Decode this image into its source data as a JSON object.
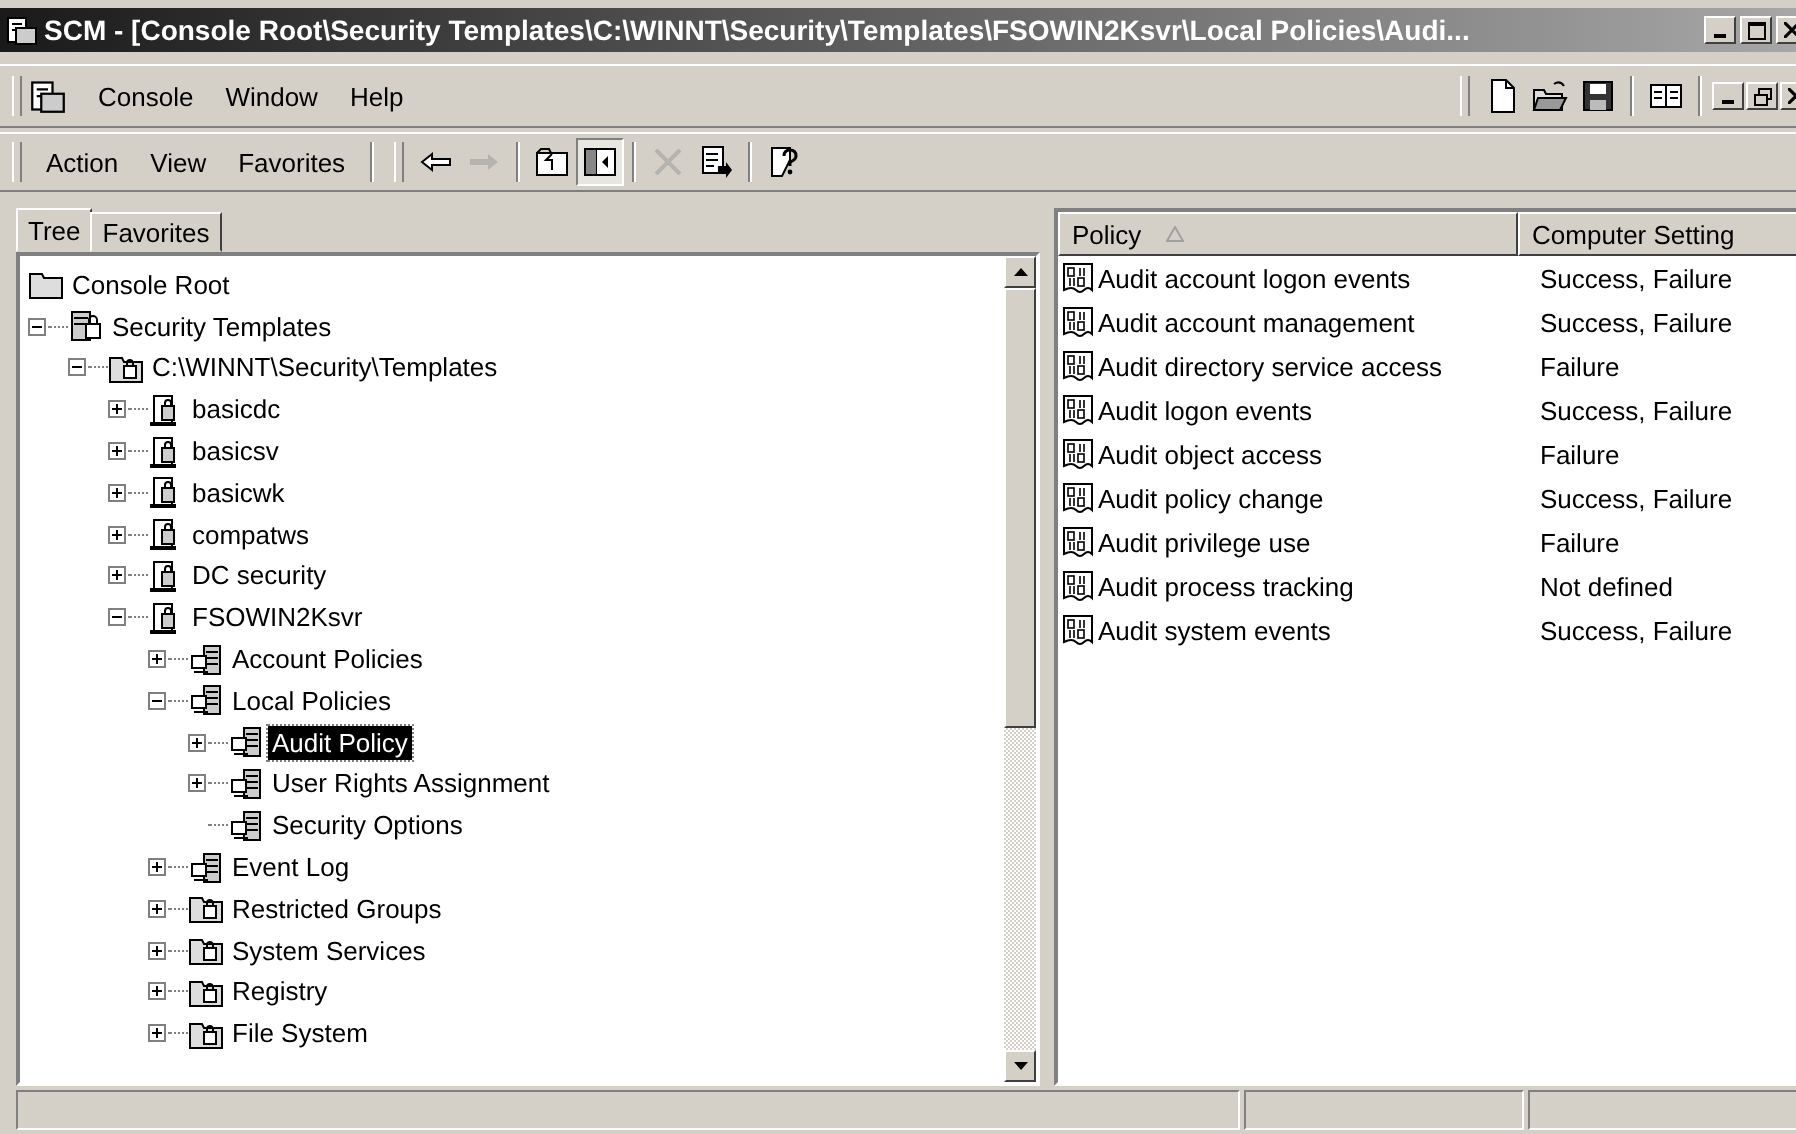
{
  "window": {
    "title": "SCM - [Console Root\\Security Templates\\C:\\WINNT\\Security\\Templates\\FSOWIN2Ksvr\\Local Policies\\Audi..."
  },
  "menu_bar": {
    "items": [
      {
        "label": "Console"
      },
      {
        "label": "Window"
      },
      {
        "label": "Help"
      }
    ],
    "tools": [
      {
        "kind": "new"
      },
      {
        "kind": "open"
      },
      {
        "kind": "save"
      },
      {
        "kind": "tree"
      }
    ]
  },
  "action_bar": {
    "menus": [
      {
        "label": "Action"
      },
      {
        "label": "View"
      },
      {
        "label": "Favorites"
      }
    ],
    "tools": [
      {
        "kind": "back",
        "disabled": false,
        "pressed": false
      },
      {
        "kind": "forward",
        "disabled": true,
        "pressed": false
      },
      {
        "kind": "up",
        "disabled": false,
        "pressed": false
      },
      {
        "kind": "showtree",
        "disabled": false,
        "pressed": true
      },
      {
        "kind": "delete",
        "disabled": true,
        "pressed": false
      },
      {
        "kind": "export",
        "disabled": false,
        "pressed": false
      },
      {
        "kind": "help",
        "disabled": false,
        "pressed": false
      }
    ]
  },
  "tabs": [
    {
      "label": "Tree",
      "selected": true
    },
    {
      "label": "Favorites",
      "selected": false
    }
  ],
  "tree": [
    {
      "label": "Console Root",
      "kind": "folder",
      "selected": false,
      "children": [
        {
          "label": "Security Templates",
          "kind": "snapin",
          "expanded": true,
          "selected": false,
          "children": [
            {
              "label": "C:\\WINNT\\Security\\Templates",
              "kind": "lockfolder",
              "expanded": true,
              "selected": false,
              "children": [
                {
                  "label": "basicdc",
                  "kind": "template",
                  "expanded": false,
                  "selected": false
                },
                {
                  "label": "basicsv",
                  "kind": "template",
                  "expanded": false,
                  "selected": false
                },
                {
                  "label": "basicwk",
                  "kind": "template",
                  "expanded": false,
                  "selected": false
                },
                {
                  "label": "compatws",
                  "kind": "template",
                  "expanded": false,
                  "selected": false
                },
                {
                  "label": "DC security",
                  "kind": "template",
                  "expanded": false,
                  "selected": false
                },
                {
                  "label": "FSOWIN2Ksvr",
                  "kind": "template",
                  "expanded": true,
                  "selected": false,
                  "children": [
                    {
                      "label": "Account Policies",
                      "kind": "policy",
                      "expanded": false,
                      "selected": false
                    },
                    {
                      "label": "Local Policies",
                      "kind": "policy",
                      "expanded": true,
                      "selected": false,
                      "children": [
                        {
                          "label": "Audit Policy",
                          "kind": "policy",
                          "expanded": false,
                          "selected": true
                        },
                        {
                          "label": "User Rights Assignment",
                          "kind": "policy",
                          "expanded": false,
                          "selected": false
                        },
                        {
                          "label": "Security Options",
                          "kind": "policy",
                          "selected": false
                        }
                      ]
                    },
                    {
                      "label": "Event Log",
                      "kind": "policy",
                      "expanded": false,
                      "selected": false
                    },
                    {
                      "label": "Restricted Groups",
                      "kind": "lockfolder",
                      "expanded": false,
                      "selected": false
                    },
                    {
                      "label": "System Services",
                      "kind": "lockfolder",
                      "expanded": false,
                      "selected": false
                    },
                    {
                      "label": "Registry",
                      "kind": "lockfolder",
                      "expanded": false,
                      "selected": false
                    },
                    {
                      "label": "File System",
                      "kind": "lockfolder",
                      "expanded": false,
                      "selected": false
                    }
                  ]
                }
              ]
            }
          ]
        }
      ]
    }
  ],
  "list": {
    "columns": [
      {
        "label": "Policy",
        "sorted": true
      },
      {
        "label": "Computer Setting",
        "sorted": false
      }
    ],
    "rows": [
      {
        "policy": "Audit account logon events",
        "setting": "Success, Failure"
      },
      {
        "policy": "Audit account management",
        "setting": "Success, Failure"
      },
      {
        "policy": "Audit directory service access",
        "setting": "Failure"
      },
      {
        "policy": "Audit logon events",
        "setting": "Success, Failure"
      },
      {
        "policy": "Audit object access",
        "setting": "Failure"
      },
      {
        "policy": "Audit policy change",
        "setting": "Success, Failure"
      },
      {
        "policy": "Audit privilege use",
        "setting": "Failure"
      },
      {
        "policy": "Audit process tracking",
        "setting": "Not defined"
      },
      {
        "policy": "Audit system events",
        "setting": "Success, Failure"
      }
    ]
  }
}
